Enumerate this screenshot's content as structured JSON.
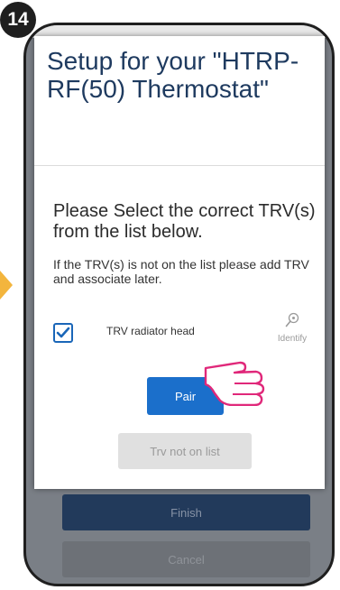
{
  "step": {
    "number": "14"
  },
  "dialog": {
    "title": "Setup for your \"HTRP-RF(50) Thermostat\"",
    "prompt": "Please Select the correct TRV(s) from the list below.",
    "hint": "If the TRV(s) is not on the list please add TRV and associate later.",
    "trv_item": {
      "label": "TRV radiator head",
      "checked": true,
      "identify_label": "Identify",
      "identify_icon": "magnifier-icon"
    },
    "pair_label": "Pair",
    "trv_not_on_list_label": "Trv not on list"
  },
  "background": {
    "finish_label": "Finish",
    "cancel_label": "Cancel"
  },
  "colors": {
    "accent": "#1b6fcb",
    "title": "#1e3a5f",
    "arrow": "#f3b53d",
    "hand": "#e0287a"
  }
}
